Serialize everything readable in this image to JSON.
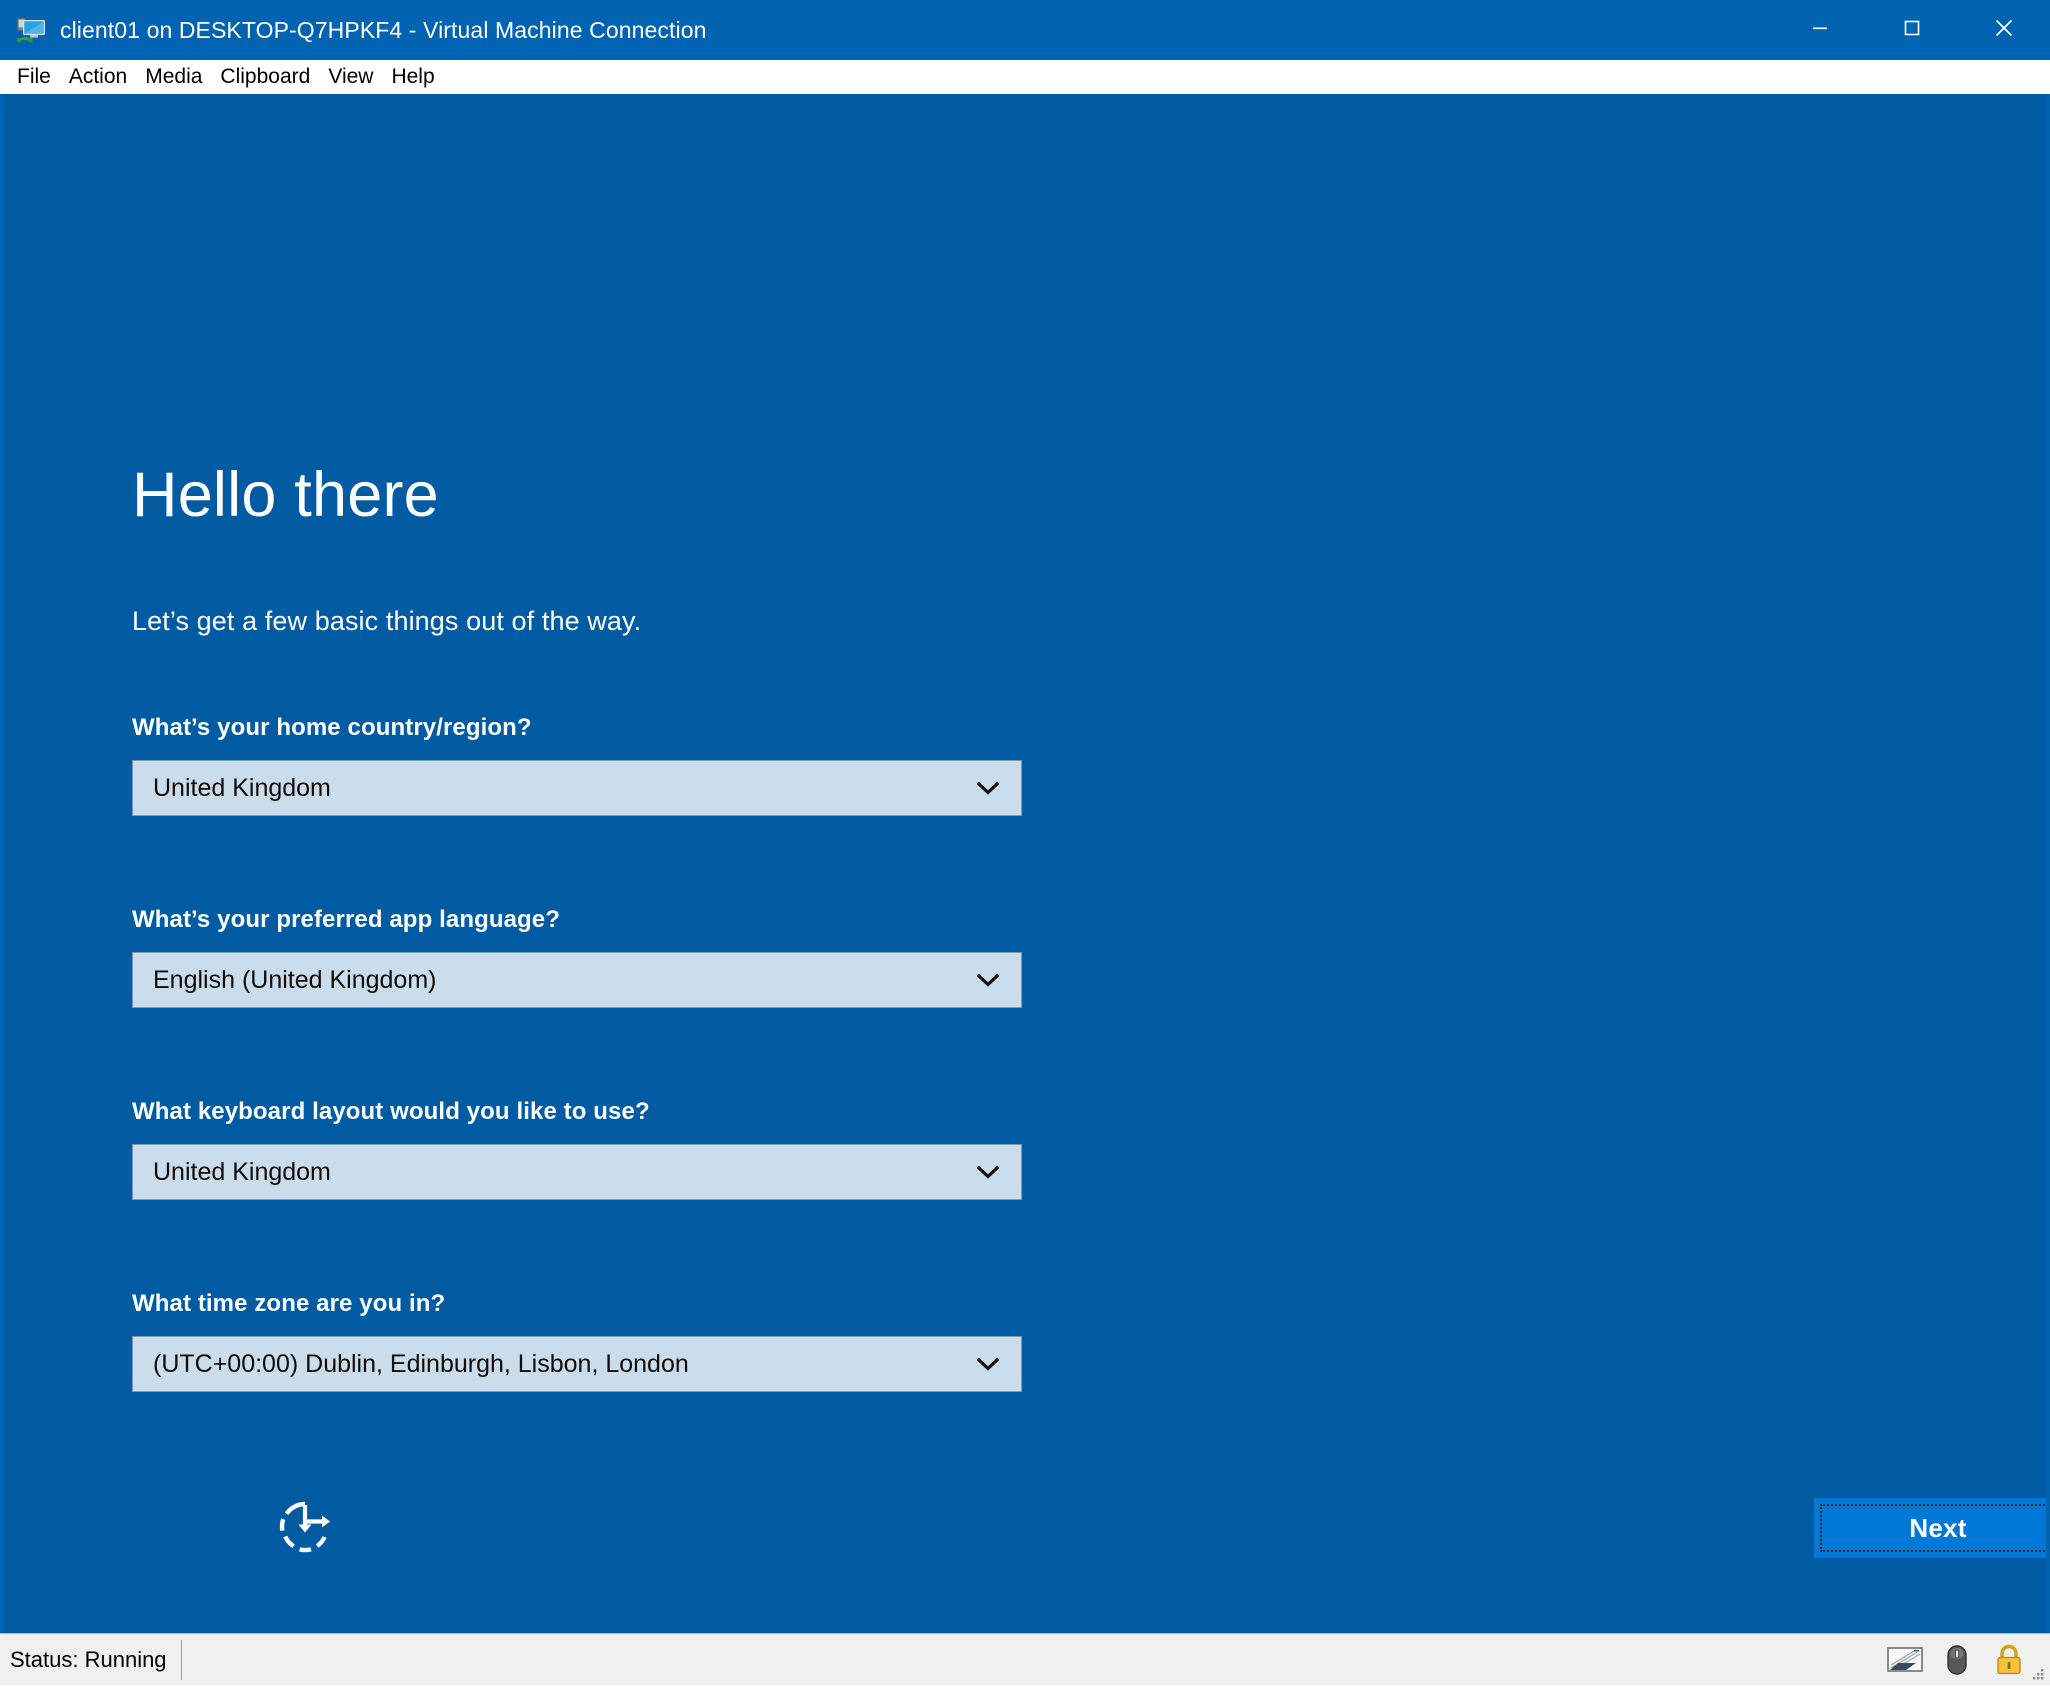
{
  "window": {
    "title": "client01 on DESKTOP-Q7HPKF4 - Virtual Machine Connection",
    "icon": "virtual-machine-icon",
    "accent_color": "#0063B1",
    "controls": {
      "minimize": "minimize-icon",
      "maximize": "maximize-icon",
      "close": "close-icon"
    }
  },
  "menubar": {
    "items": [
      {
        "label": "File"
      },
      {
        "label": "Action"
      },
      {
        "label": "Media"
      },
      {
        "label": "Clipboard"
      },
      {
        "label": "View"
      },
      {
        "label": "Help"
      }
    ]
  },
  "oobe": {
    "background_color": "#005BA3",
    "heading": "Hello there",
    "subheading": "Let’s get a few basic things out of the way.",
    "fields": [
      {
        "label": "What’s your home country/region?",
        "value": "United Kingdom",
        "icon": "chevron-down-icon"
      },
      {
        "label": "What’s your preferred app language?",
        "value": "English (United Kingdom)",
        "icon": "chevron-down-icon"
      },
      {
        "label": "What keyboard layout would you like to use?",
        "value": "United Kingdom",
        "icon": "chevron-down-icon"
      },
      {
        "label": "What time zone are you in?",
        "value": "(UTC+00:00) Dublin, Edinburgh, Lisbon, London",
        "icon": "chevron-down-icon"
      }
    ],
    "ease_of_access": {
      "icon": "ease-of-access-icon"
    },
    "next_button": {
      "label": "Next",
      "color": "#0078D7",
      "focused": true
    }
  },
  "statusbar": {
    "status_text": "Status: Running",
    "icons": [
      {
        "name": "keyboard-capture-icon"
      },
      {
        "name": "mouse-capture-icon"
      },
      {
        "name": "lock-icon"
      }
    ],
    "grip": "resize-grip-icon"
  }
}
